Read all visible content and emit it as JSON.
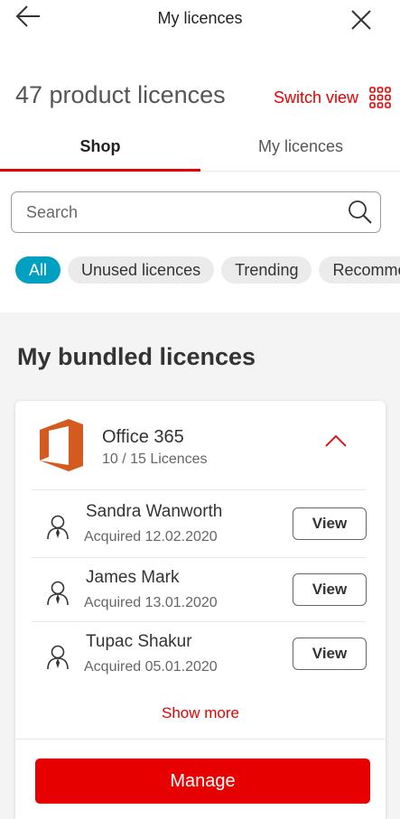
{
  "header": {
    "title": "My licences"
  },
  "summary": {
    "count_text": "47 product licences",
    "switch_view_label": "Switch view"
  },
  "tabs": [
    {
      "label": "Shop",
      "active": true
    },
    {
      "label": "My licences",
      "active": false
    }
  ],
  "search": {
    "placeholder": "Search",
    "value": ""
  },
  "filters": [
    {
      "label": "All",
      "active": true
    },
    {
      "label": "Unused licences",
      "active": false
    },
    {
      "label": "Trending",
      "active": false
    },
    {
      "label": "Recommended",
      "active": false
    }
  ],
  "section": {
    "title": "My bundled licences"
  },
  "product": {
    "name": "Office 365",
    "licences_text": "10 / 15 Licences",
    "users": [
      {
        "name": "Sandra Wanworth",
        "acquired": "Acquired  12.02.2020",
        "action": "View"
      },
      {
        "name": "James Mark",
        "acquired": "Acquired 13.01.2020",
        "action": "View"
      },
      {
        "name": "Tupac Shakur",
        "acquired": "Acquired 05.01.2020",
        "action": "View"
      }
    ],
    "show_more_label": "Show more",
    "manage_label": "Manage"
  },
  "colors": {
    "brand_red": "#e60000",
    "accent_teal": "#00a0c0",
    "office_orange": "#d35b1f"
  },
  "icons": {
    "back": "arrow-left-icon",
    "close": "close-icon",
    "grid": "grid-icon",
    "search": "search-icon",
    "product": "office-logo-icon",
    "collapse": "chevron-up-icon",
    "user": "user-icon"
  }
}
